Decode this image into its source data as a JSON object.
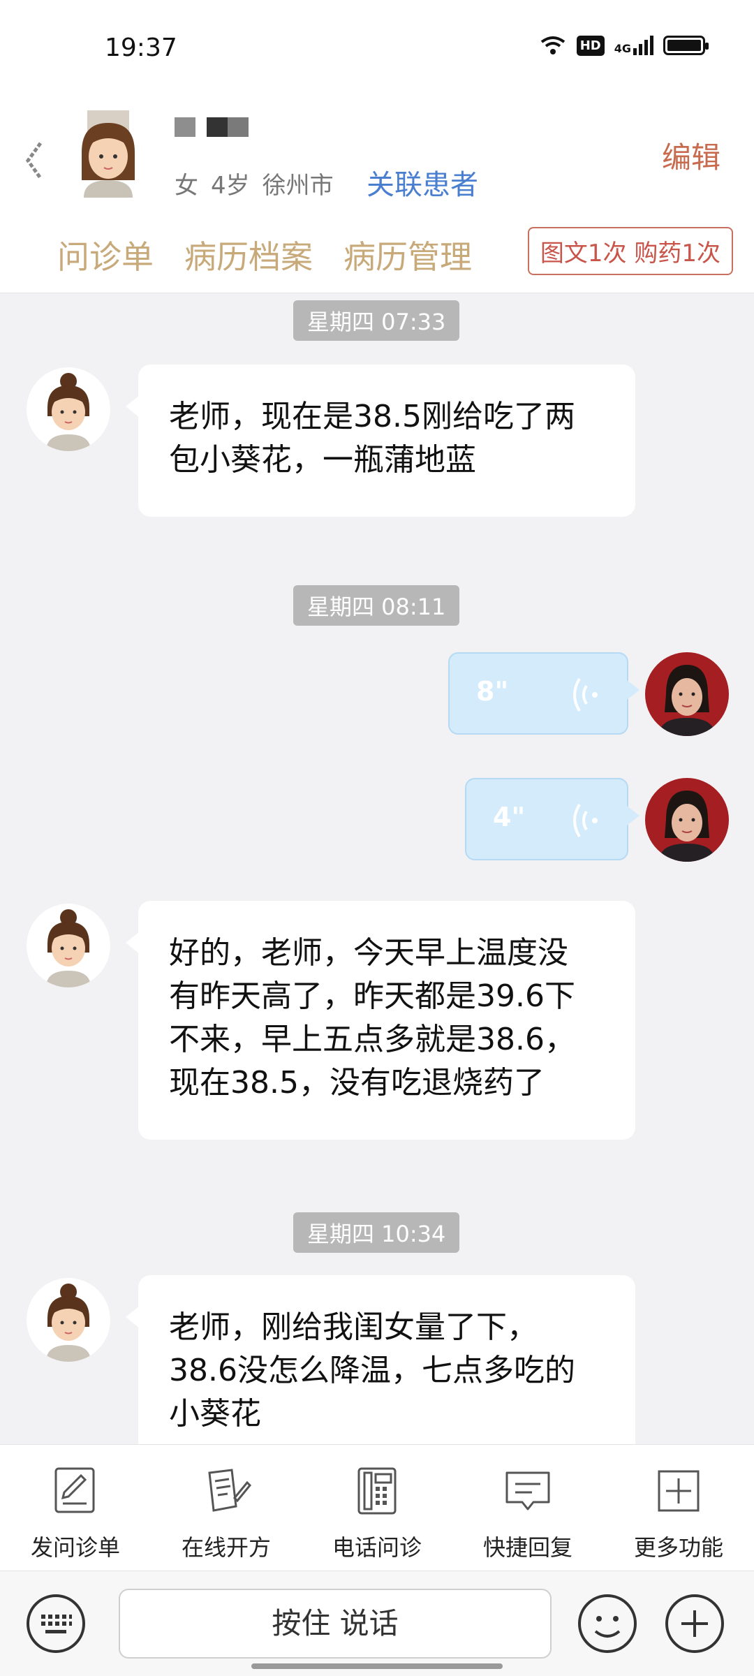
{
  "status": {
    "time": "19:37",
    "hd": "HD",
    "network": "4G"
  },
  "header": {
    "gender": "女",
    "age": "4岁",
    "city": "徐州市",
    "link_patient": "关联患者",
    "edit": "编辑",
    "tabs": [
      "问诊单",
      "病历档案",
      "病历管理"
    ],
    "count_badge": "图文1次 购药1次"
  },
  "chat": [
    {
      "type": "time",
      "text": "星期四 07:33"
    },
    {
      "type": "text",
      "side": "left",
      "text": [
        "老师，现在是38.5刚给吃了两",
        "包小葵花，一瓶蒲地蓝"
      ]
    },
    {
      "type": "time",
      "text": "星期四 08:11"
    },
    {
      "type": "voice",
      "side": "right",
      "duration": "8\""
    },
    {
      "type": "voice",
      "side": "right",
      "duration": "4\""
    },
    {
      "type": "text",
      "side": "left",
      "text": [
        "好的，老师，今天早上温度没",
        "有昨天高了，昨天都是39.6下",
        "不来，早上五点多就是38.6，",
        "现在38.5，没有吃退烧药了"
      ]
    },
    {
      "type": "time",
      "text": "星期四 10:34"
    },
    {
      "type": "text",
      "side": "left",
      "text": [
        "老师，刚给我闺女量了下，",
        "38.6没怎么降温，七点多吃的",
        "小葵花"
      ]
    }
  ],
  "toolbar": [
    {
      "label": "发问诊单",
      "icon": "form-edit-icon"
    },
    {
      "label": "在线开方",
      "icon": "prescription-icon"
    },
    {
      "label": "电话问诊",
      "icon": "phone-icon"
    },
    {
      "label": "快捷回复",
      "icon": "message-icon"
    },
    {
      "label": "更多功能",
      "icon": "plus-square-icon"
    }
  ],
  "input": {
    "hold_to_talk": "按住 说话"
  },
  "colors": {
    "accent_tab": "#c7a97a",
    "link": "#4a7fd0",
    "edit": "#c86a4e",
    "voice_bubble": "#d4ebfb"
  }
}
